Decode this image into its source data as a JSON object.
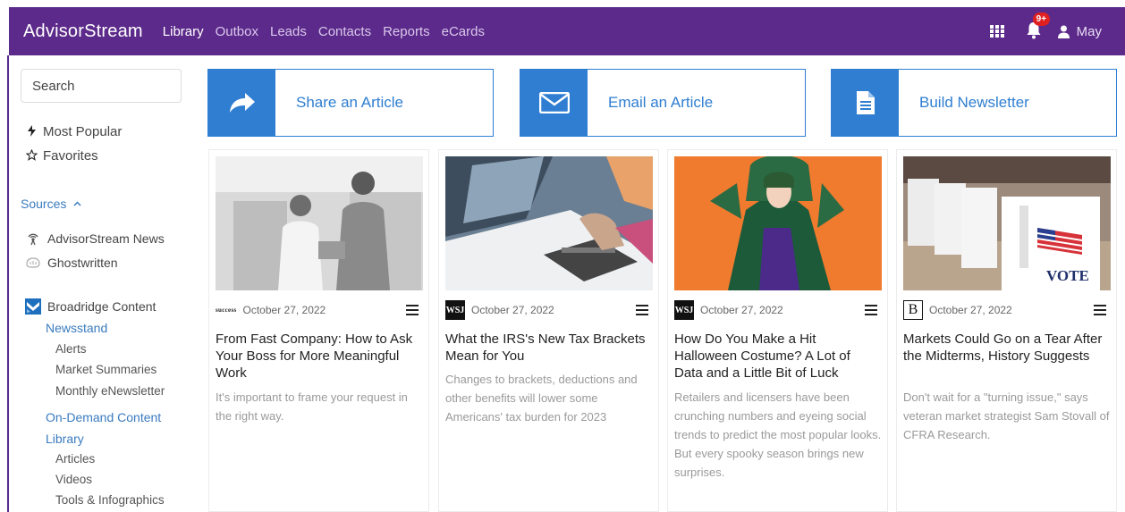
{
  "nav": {
    "brand": "AdvisorStream",
    "links": [
      "Library",
      "Outbox",
      "Leads",
      "Contacts",
      "Reports",
      "eCards"
    ],
    "active": "Library",
    "notification_badge": "9+",
    "user_name": "May",
    "bar_color": "#5c2a8a"
  },
  "sidebar": {
    "search_placeholder": "Search",
    "most_popular": "Most Popular",
    "favorites": "Favorites",
    "sources_label": "Sources",
    "source_items": [
      "AdvisorStream News",
      "Ghostwritten"
    ],
    "broadridge": "Broadridge Content",
    "newsstand": "Newsstand",
    "newsstand_items": [
      "Alerts",
      "Market Summaries",
      "Monthly eNewsletter"
    ],
    "on_demand": "On-Demand Content",
    "library": "Library",
    "library_items": [
      "Articles",
      "Videos",
      "Tools & Infographics"
    ]
  },
  "actions": [
    {
      "label": "Share an Article",
      "icon": "share-icon"
    },
    {
      "label": "Email an Article",
      "icon": "envelope-icon"
    },
    {
      "label": "Build Newsletter",
      "icon": "document-icon"
    }
  ],
  "accent_color": "#2f7ed1",
  "cards": [
    {
      "source": "success",
      "date": "October 27, 2022",
      "title": "From Fast Company: How to Ask Your Boss for More Meaningful Work",
      "description": "It's important to frame your request in the right way."
    },
    {
      "source": "WSJ",
      "date": "October 27, 2022",
      "title": "What the IRS's New Tax Brackets Mean for You",
      "description": "Changes to brackets, deductions and other benefits will lower some Americans' tax burden for 2023"
    },
    {
      "source": "WSJ",
      "date": "October 27, 2022",
      "title": "How Do You Make a Hit Halloween Costume? A Lot of Data and a Little Bit of Luck",
      "description": "Retailers and licensers have been crunching numbers and eyeing social trends to predict the most popular looks. But every spooky season brings new surprises."
    },
    {
      "source": "B",
      "date": "October 27, 2022",
      "title": "Markets Could Go on a Tear After the Midterms, History Suggests",
      "description": "Don't wait for a \"turning issue,\" says veteran market strategist Sam Stovall of CFRA Research.",
      "image_sign_text": "VOTE"
    }
  ]
}
